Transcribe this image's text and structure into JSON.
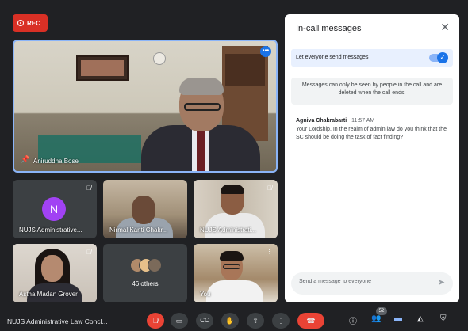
{
  "rec": {
    "label": "REC"
  },
  "participants": {
    "main": {
      "name": "Aniruddha Bose"
    },
    "tiles": [
      {
        "name": "NUJS Administrative...",
        "initial": "N",
        "avatar_color": "#a142f4"
      },
      {
        "name": "Nirmal Kanti Chakr..."
      },
      {
        "name": "NUJS Administrati..."
      },
      {
        "name": "Astha Madan Grover"
      },
      {
        "name": "46 others"
      },
      {
        "name": "You"
      }
    ]
  },
  "chat": {
    "title": "In-call messages",
    "toggle_label": "Let everyone send messages",
    "notice": "Messages can only be seen by people in the call and are deleted when the call ends.",
    "messages": [
      {
        "sender": "Agniva Chakrabarti",
        "time": "11:57 AM",
        "text": "Your Lordship, In the realm of admin law do you think that the SC should be doing the task of fact finding?"
      }
    ],
    "input_placeholder": "Send a message to everyone"
  },
  "bottom_bar": {
    "meeting_name": "NUJS Administrative Law Concl...",
    "participants_count": "52"
  },
  "colors": {
    "background": "#202124",
    "accent": "#1a73e8",
    "rec": "#d93025",
    "end_call": "#ea4335"
  }
}
